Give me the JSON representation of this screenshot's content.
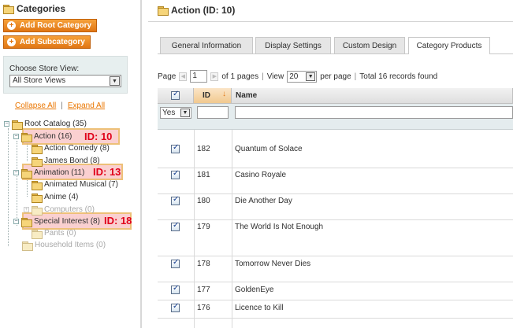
{
  "sidebar": {
    "title": "Categories",
    "add_root_label": "Add Root Category",
    "add_sub_label": "Add Subcategory",
    "store_view_label": "Choose Store View:",
    "store_view_value": "All Store Views",
    "collapse_all": "Collapse All",
    "expand_all": "Expand All",
    "link_separator": "|",
    "tree": [
      {
        "label": "Root Catalog (35)",
        "dim": false
      },
      {
        "label": "Action (16)",
        "dim": false
      },
      {
        "label": "Action Comedy (8)",
        "dim": false
      },
      {
        "label": "James Bond (8)",
        "dim": false
      },
      {
        "label": "Animation (11)",
        "dim": false
      },
      {
        "label": "Animated Musical (7)",
        "dim": false
      },
      {
        "label": "Anime (4)",
        "dim": false
      },
      {
        "label": "Computers (0)",
        "dim": true
      },
      {
        "label": "Special Interest (8)",
        "dim": false
      },
      {
        "label": "Pants (0)",
        "dim": true
      },
      {
        "label": "Household Items (0)",
        "dim": true
      }
    ],
    "annotations": [
      "ID: 10",
      "ID: 13",
      "ID: 18"
    ]
  },
  "main": {
    "title": "Action (ID: 10)",
    "tabs": [
      {
        "label": "General Information",
        "active": false
      },
      {
        "label": "Display Settings",
        "active": false
      },
      {
        "label": "Custom Design",
        "active": false
      },
      {
        "label": "Category Products",
        "active": true
      }
    ],
    "pager": {
      "page_label": "Page",
      "page_value": "1",
      "of_pages": "of 1 pages",
      "view_label": "View",
      "view_value": "20",
      "per_page": "per page",
      "total": "Total 16 records found",
      "separator": "|"
    },
    "grid": {
      "columns": [
        "ID",
        "Name"
      ],
      "filter_yes": "Yes",
      "rows": [
        {
          "id": "182",
          "name": "Quantum of Solace"
        },
        {
          "id": "181",
          "name": "Casino Royale"
        },
        {
          "id": "180",
          "name": "Die Another Day"
        },
        {
          "id": "179",
          "name": "The World Is Not Enough"
        },
        {
          "id": "178",
          "name": "Tomorrow Never Dies"
        },
        {
          "id": "177",
          "name": "GoldenEye"
        },
        {
          "id": "176",
          "name": "Licence to Kill"
        }
      ]
    }
  },
  "colors": {
    "accent": "#ea7601",
    "annotation": "#e0001a",
    "highlight": "#f08080"
  }
}
